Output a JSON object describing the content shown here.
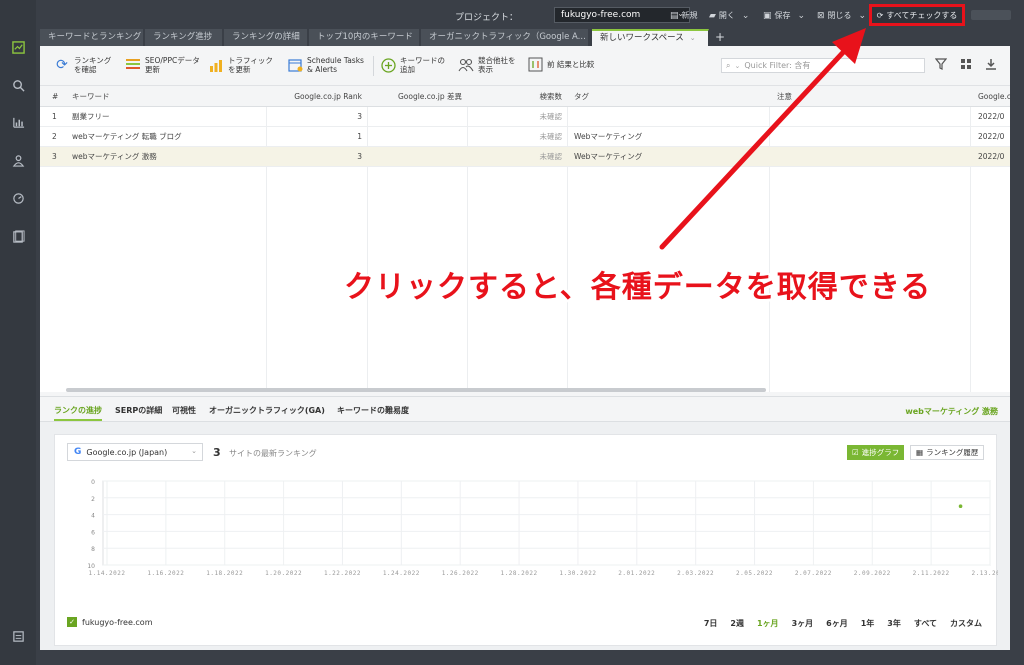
{
  "topbar": {
    "project_label": "プロジェクト：",
    "project_value": "fukugyo-free.com",
    "new_label": "新規",
    "open_label": "開く",
    "save_label": "保存",
    "close_label": "閉じる",
    "check_all_label": "すべてチェックする"
  },
  "tabs": [
    {
      "label": "キーワードとランキング"
    },
    {
      "label": "ランキング進捗"
    },
    {
      "label": "ランキングの詳細"
    },
    {
      "label": "トップ10内のキーワード"
    },
    {
      "label": "オーガニックトラフィック（Google A..."
    },
    {
      "label": "新しいワークスペース"
    }
  ],
  "toolbar": {
    "check_rank": "ランキング\nを確認",
    "seo_ppc": "SEO/PPCデータ\n更新",
    "traffic": "トラフィック\nを更新",
    "schedule": "Schedule Tasks\n& Alerts",
    "add_keyword": "キーワードの\n追加",
    "competitors": "競合他社を\n表示",
    "compare": "前 結果と比較",
    "quick_filter_placeholder": "Quick Filter: 含有"
  },
  "table": {
    "headers": {
      "num": "#",
      "keyword": "キーワード",
      "rank": "Google.co.jp Rank",
      "diff": "Google.co.jp 差異",
      "volume": "検索数",
      "tag": "タグ",
      "note": "注意",
      "url": "Google.c"
    },
    "rows": [
      {
        "num": "1",
        "keyword": "副業フリー",
        "rank": "3",
        "diff": "",
        "volume": "未確認",
        "tag": "",
        "note": "",
        "url": "2022/0"
      },
      {
        "num": "2",
        "keyword": "webマーケティング 転職 ブログ",
        "rank": "1",
        "diff": "",
        "volume": "未確認",
        "tag": "Webマーケティング",
        "note": "",
        "url": "2022/0"
      },
      {
        "num": "3",
        "keyword": "webマーケティング 激務",
        "rank": "3",
        "diff": "",
        "volume": "未確認",
        "tag": "Webマーケティング",
        "note": "",
        "url": "2022/0"
      }
    ]
  },
  "bottom": {
    "tabs": [
      "ランクの進捗",
      "SERPの詳細",
      "可視性",
      "オーガニックトラフィック(GA)",
      "キーワードの難易度"
    ],
    "selected_keyword": "webマーケティング 激務",
    "engine": "Google.co.jp (Japan)",
    "site_count": "3",
    "site_count_label": "サイトの最新ランキング",
    "graph_button": "進捗グラフ",
    "history_button": "ランキング履歴",
    "legend_site": "fukugyo-free.com",
    "ranges": [
      "7日",
      "2週",
      "1ヶ月",
      "3ヶ月",
      "6ヶ月",
      "1年",
      "3年",
      "すべて",
      "カスタム"
    ],
    "active_range": "1ヶ月"
  },
  "chart_data": {
    "type": "scatter",
    "title": "",
    "xlabel": "",
    "ylabel": "",
    "x_ticks": [
      "1.14.2022",
      "1.16.2022",
      "1.18.2022",
      "1.20.2022",
      "1.22.2022",
      "1.24.2022",
      "1.26.2022",
      "1.28.2022",
      "1.30.2022",
      "2.01.2022",
      "2.03.2022",
      "2.05.2022",
      "2.07.2022",
      "2.09.2022",
      "2.11.2022",
      "2.13.2022"
    ],
    "y_ticks": [
      "0",
      "2",
      "4",
      "6",
      "8",
      "10"
    ],
    "ylim": [
      0,
      10
    ],
    "y_inverted": true,
    "series": [
      {
        "name": "fukugyo-free.com",
        "points": [
          {
            "x": "2.12.2022",
            "y": 3
          }
        ],
        "color": "#7ab733"
      }
    ]
  },
  "annotation": {
    "text": "クリックすると、各種データを取得できる",
    "color": "#e8121b"
  },
  "colors": {
    "accent": "#8cc63f",
    "highlight": "#e8121b"
  }
}
